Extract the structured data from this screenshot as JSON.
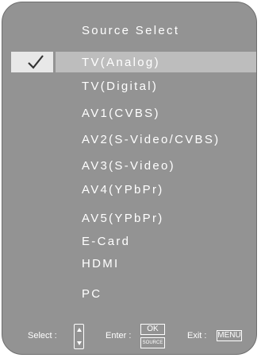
{
  "header": {
    "title": "Source Select"
  },
  "menu": {
    "selected_index": 0,
    "items": [
      {
        "label": "TV(Analog)"
      },
      {
        "label": "TV(Digital)"
      },
      {
        "label": "AV1(CVBS)"
      },
      {
        "label": "AV2(S-Video/CVBS)"
      },
      {
        "label": "AV3(S-Video)"
      },
      {
        "label": "AV4(YPbPr)"
      },
      {
        "label": "AV5(YPbPr)"
      },
      {
        "label": "E-Card"
      },
      {
        "label": "HDMI"
      },
      {
        "label": "PC"
      }
    ]
  },
  "footer": {
    "select_label": "Select :",
    "enter_label": "Enter :",
    "ok_key": "OK",
    "source_key": "SOURCE",
    "exit_label": "Exit :",
    "menu_key": "MENU"
  },
  "icons": {
    "checkmark": "check-icon",
    "updown": "up-down-arrows-icon"
  },
  "colors": {
    "panel_bg": "#939393",
    "highlight_bar": "#bdbdbd",
    "check_box": "#e8e8e8",
    "text": "#ffffff"
  }
}
